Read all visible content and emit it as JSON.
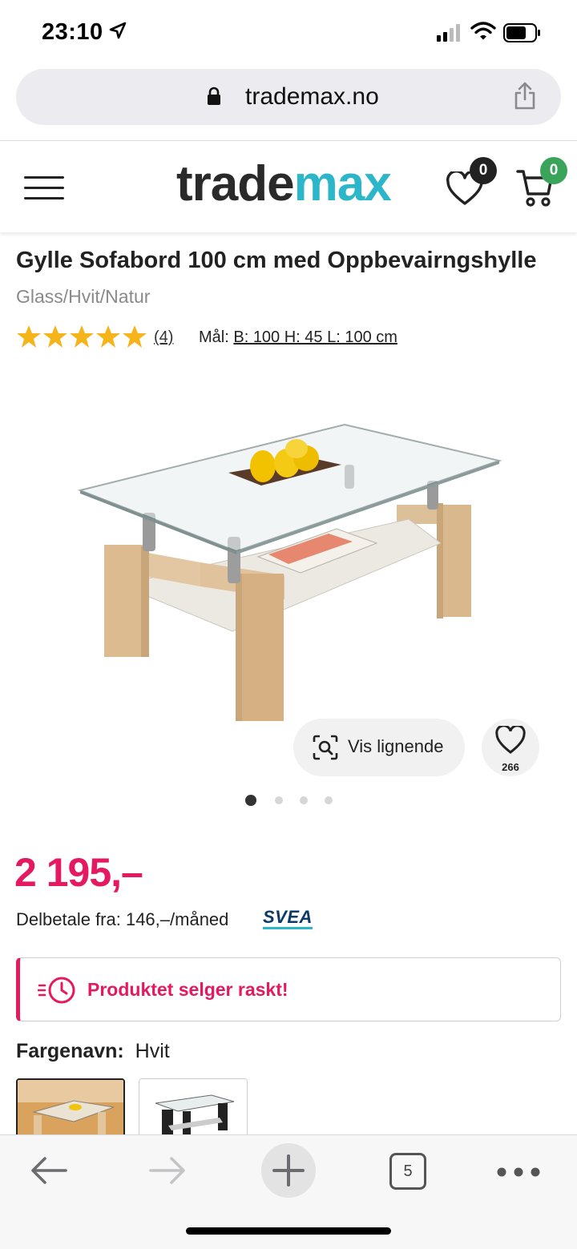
{
  "status_bar": {
    "time": "23:10"
  },
  "browser": {
    "url": "trademax.no",
    "tab_count": "5"
  },
  "header": {
    "logo_part1": "trade",
    "logo_part2": "max",
    "wishlist_count": "0",
    "cart_count": "0"
  },
  "product": {
    "title": "Gylle Sofabord 100 cm med Oppbevairngshylle",
    "variant": "Glass/Hvit/Natur",
    "rating": 5,
    "review_count": "(4)",
    "dims_label": "Mål:",
    "dims_value": "B: 100 H: 45 L: 100 cm",
    "vis_lignende": "Vis lignende",
    "favorite_count": "266",
    "image_count": 4,
    "active_image": 1,
    "price": "2 195,–",
    "installment": "Delbetale fra: 146,–/måned",
    "installment_provider": "SVEA",
    "alert": "Produktet selger raskt!",
    "color_label": "Fargenavn:",
    "color_value": "Hvit"
  },
  "colors": {
    "accent": "#e5195f",
    "brand_teal": "#2bb6c9"
  }
}
